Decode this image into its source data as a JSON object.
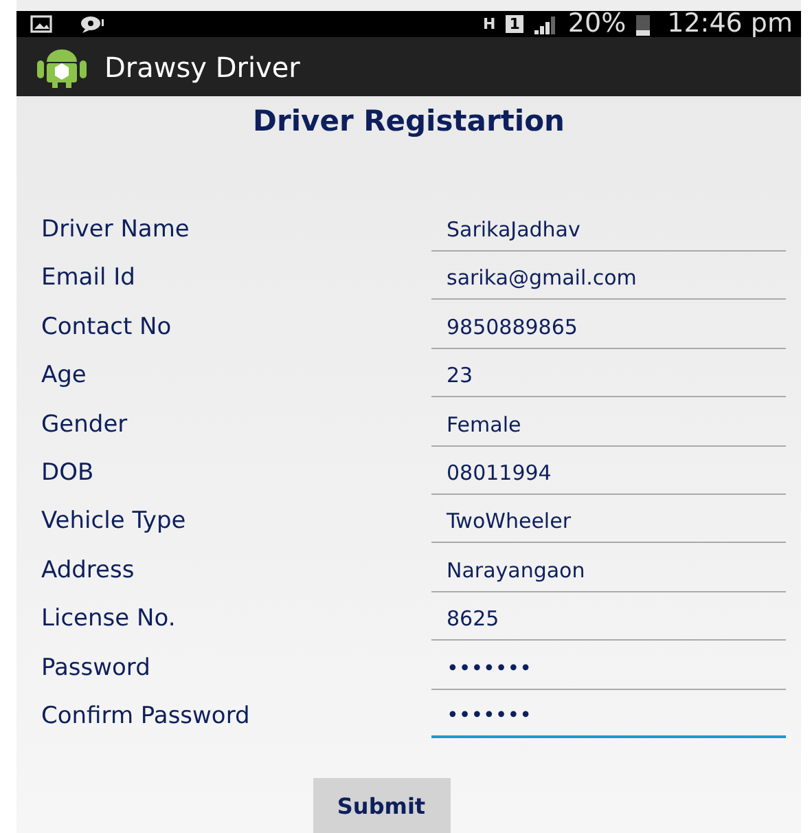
{
  "status_bar": {
    "network": "H",
    "sim": "1",
    "battery": "20%",
    "time": "12:46 pm"
  },
  "app_bar": {
    "title": "Drawsy Driver"
  },
  "form": {
    "title": "Driver Registartion",
    "fields": [
      {
        "label": "Driver Name",
        "value": "SarikaJadhav",
        "focused": false
      },
      {
        "label": "Email Id",
        "value": "sarika@gmail.com",
        "focused": false
      },
      {
        "label": "Contact No",
        "value": "9850889865",
        "focused": false
      },
      {
        "label": "Age",
        "value": "23",
        "focused": false
      },
      {
        "label": "Gender",
        "value": "Female",
        "focused": false
      },
      {
        "label": "DOB",
        "value": "08011994",
        "focused": false
      },
      {
        "label": "Vehicle Type",
        "value": "TwoWheeler",
        "focused": false
      },
      {
        "label": "Address",
        "value": "Narayangaon",
        "focused": false
      },
      {
        "label": "License No.",
        "value": "8625",
        "focused": false
      },
      {
        "label": "Password",
        "value": "•••••••",
        "focused": false
      },
      {
        "label": "Confirm Password",
        "value": "•••••••",
        "focused": true
      }
    ],
    "submit": "Submit"
  }
}
